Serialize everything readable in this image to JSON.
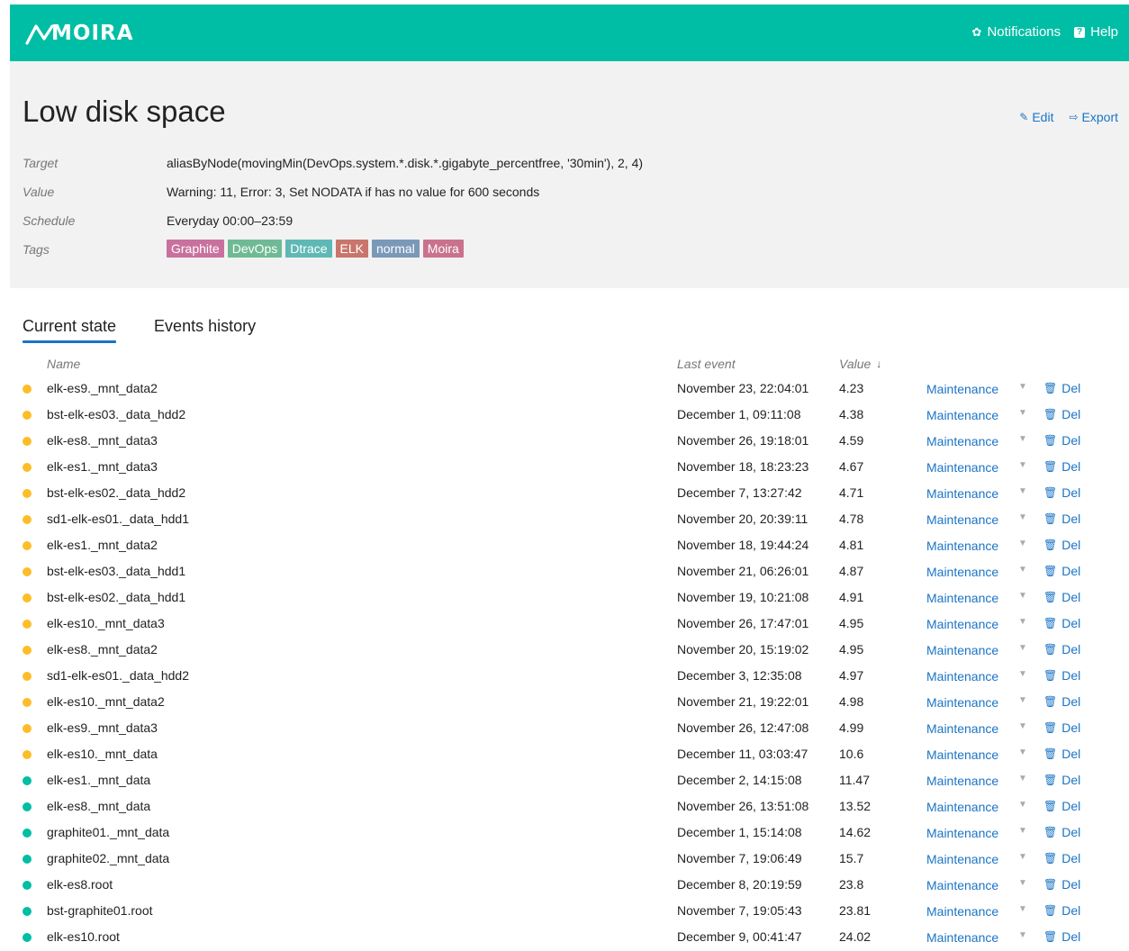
{
  "header": {
    "logo_text": "MOIRA",
    "notifications_label": "Notifications",
    "help_label": "Help"
  },
  "trigger": {
    "title": "Low disk space",
    "edit_label": "Edit",
    "export_label": "Export",
    "target_label": "Target",
    "target_value": "aliasByNode(movingMin(DevOps.system.*.disk.*.gigabyte_percentfree, '30min'), 2, 4)",
    "value_label": "Value",
    "value_value": "Warning: 11, Error: 3, Set NODATA if has no value for 600 seconds",
    "schedule_label": "Schedule",
    "schedule_value": "Everyday 00:00–23:59",
    "tags_label": "Tags",
    "tags": [
      {
        "label": "Graphite",
        "color": "#c9719e"
      },
      {
        "label": "DevOps",
        "color": "#6fba94"
      },
      {
        "label": "Dtrace",
        "color": "#5fb8b5"
      },
      {
        "label": "ELK",
        "color": "#c9756c"
      },
      {
        "label": "normal",
        "color": "#7a99b8"
      },
      {
        "label": "Moira",
        "color": "#c9728e"
      }
    ]
  },
  "tabs": [
    {
      "label": "Current state",
      "active": true
    },
    {
      "label": "Events history",
      "active": false
    }
  ],
  "table": {
    "headers": {
      "name": "Name",
      "last_event": "Last event",
      "value": "Value"
    },
    "maintenance_label": "Maintenance",
    "delete_label": "Del",
    "status_colors": {
      "warn": "#fdbd2a",
      "ok": "#00bea5"
    },
    "rows": [
      {
        "name": "elk-es9._mnt_data2",
        "last_event": "November 23, 22:04:01",
        "value": "4.23",
        "status": "warn"
      },
      {
        "name": "bst-elk-es03._data_hdd2",
        "last_event": "December 1, 09:11:08",
        "value": "4.38",
        "status": "warn"
      },
      {
        "name": "elk-es8._mnt_data3",
        "last_event": "November 26, 19:18:01",
        "value": "4.59",
        "status": "warn"
      },
      {
        "name": "elk-es1._mnt_data3",
        "last_event": "November 18, 18:23:23",
        "value": "4.67",
        "status": "warn"
      },
      {
        "name": "bst-elk-es02._data_hdd2",
        "last_event": "December 7, 13:27:42",
        "value": "4.71",
        "status": "warn"
      },
      {
        "name": "sd1-elk-es01._data_hdd1",
        "last_event": "November 20, 20:39:11",
        "value": "4.78",
        "status": "warn"
      },
      {
        "name": "elk-es1._mnt_data2",
        "last_event": "November 18, 19:44:24",
        "value": "4.81",
        "status": "warn"
      },
      {
        "name": "bst-elk-es03._data_hdd1",
        "last_event": "November 21, 06:26:01",
        "value": "4.87",
        "status": "warn"
      },
      {
        "name": "bst-elk-es02._data_hdd1",
        "last_event": "November 19, 10:21:08",
        "value": "4.91",
        "status": "warn"
      },
      {
        "name": "elk-es10._mnt_data3",
        "last_event": "November 26, 17:47:01",
        "value": "4.95",
        "status": "warn"
      },
      {
        "name": "elk-es8._mnt_data2",
        "last_event": "November 20, 15:19:02",
        "value": "4.95",
        "status": "warn"
      },
      {
        "name": "sd1-elk-es01._data_hdd2",
        "last_event": "December 3, 12:35:08",
        "value": "4.97",
        "status": "warn"
      },
      {
        "name": "elk-es10._mnt_data2",
        "last_event": "November 21, 19:22:01",
        "value": "4.98",
        "status": "warn"
      },
      {
        "name": "elk-es9._mnt_data3",
        "last_event": "November 26, 12:47:08",
        "value": "4.99",
        "status": "warn"
      },
      {
        "name": "elk-es10._mnt_data",
        "last_event": "December 11, 03:03:47",
        "value": "10.6",
        "status": "warn"
      },
      {
        "name": "elk-es1._mnt_data",
        "last_event": "December 2, 14:15:08",
        "value": "11.47",
        "status": "ok"
      },
      {
        "name": "elk-es8._mnt_data",
        "last_event": "November 26, 13:51:08",
        "value": "13.52",
        "status": "ok"
      },
      {
        "name": "graphite01._mnt_data",
        "last_event": "December 1, 15:14:08",
        "value": "14.62",
        "status": "ok"
      },
      {
        "name": "graphite02._mnt_data",
        "last_event": "November 7, 19:06:49",
        "value": "15.7",
        "status": "ok"
      },
      {
        "name": "elk-es8.root",
        "last_event": "December 8, 20:19:59",
        "value": "23.8",
        "status": "ok"
      },
      {
        "name": "bst-graphite01.root",
        "last_event": "November 7, 19:05:43",
        "value": "23.81",
        "status": "ok"
      },
      {
        "name": "elk-es10.root",
        "last_event": "December 9, 00:41:47",
        "value": "24.02",
        "status": "ok"
      }
    ]
  }
}
